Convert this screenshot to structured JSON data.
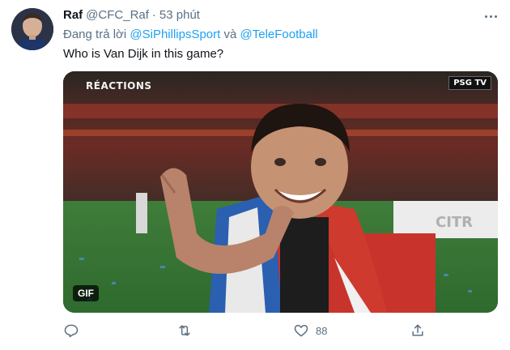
{
  "tweet": {
    "author_name": "Raf",
    "author_handle": "@CFC_Raf",
    "separator": "·",
    "timestamp": "53 phút",
    "reply_prefix": "Đang trả lời",
    "reply_to_1": "@SiPhillipsSport",
    "reply_joiner": "và",
    "reply_to_2": "@TeleFootball",
    "text": "Who is Van Dijk in this game?",
    "media": {
      "type_badge": "GIF",
      "overlay_top_left": "RÉACTIONS",
      "overlay_top_right": "PSG TV"
    },
    "actions": {
      "reply_icon": "reply-icon",
      "retweet_icon": "retweet-icon",
      "like_icon": "heart-icon",
      "like_count": "88",
      "share_icon": "share-icon"
    }
  },
  "colors": {
    "text": "#0f1419",
    "secondary": "#5b7083",
    "link": "#1da1f2"
  }
}
